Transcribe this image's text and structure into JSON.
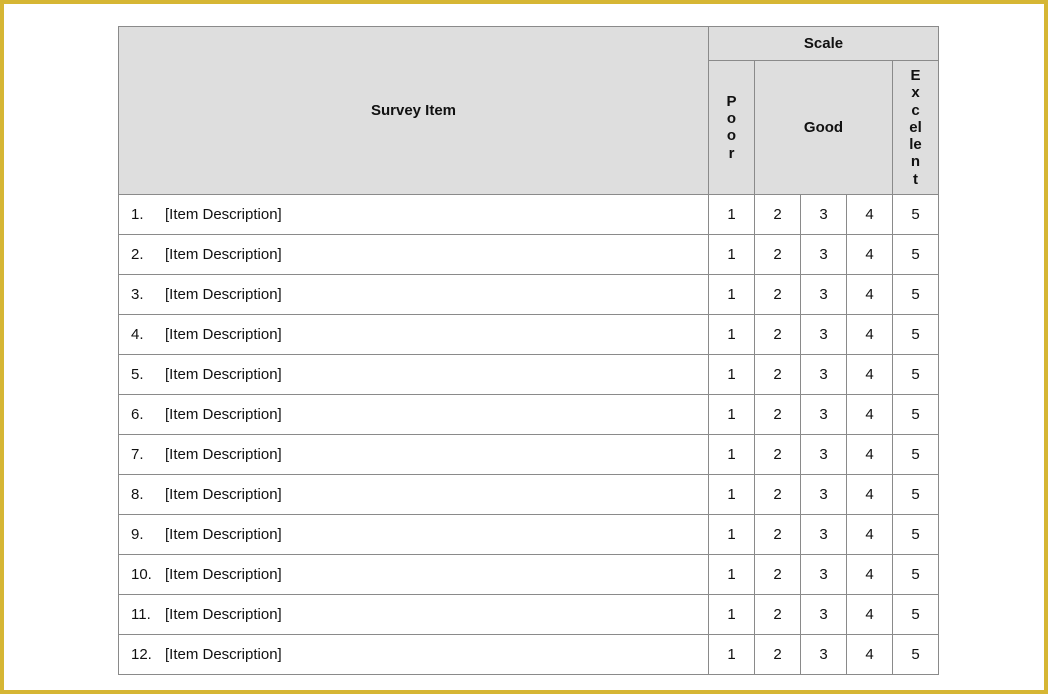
{
  "header": {
    "survey_item_label": "Survey Item",
    "scale_label": "Scale",
    "scale_poor": "Poor",
    "scale_good": "Good",
    "scale_excellent": "Excellent"
  },
  "ratings": [
    "1",
    "2",
    "3",
    "4",
    "5"
  ],
  "items": [
    {
      "num": "1.",
      "desc": "[Item Description]"
    },
    {
      "num": "2.",
      "desc": "[Item Description]"
    },
    {
      "num": "3.",
      "desc": "[Item Description]"
    },
    {
      "num": "4.",
      "desc": "[Item Description]"
    },
    {
      "num": "5.",
      "desc": "[Item Description]"
    },
    {
      "num": "6.",
      "desc": "[Item Description]"
    },
    {
      "num": "7.",
      "desc": "[Item Description]"
    },
    {
      "num": "8.",
      "desc": "[Item Description]"
    },
    {
      "num": "9.",
      "desc": "[Item Description]"
    },
    {
      "num": "10.",
      "desc": "[Item Description]"
    },
    {
      "num": "11.",
      "desc": "[Item Description]"
    },
    {
      "num": "12.",
      "desc": "[Item Description]"
    }
  ]
}
